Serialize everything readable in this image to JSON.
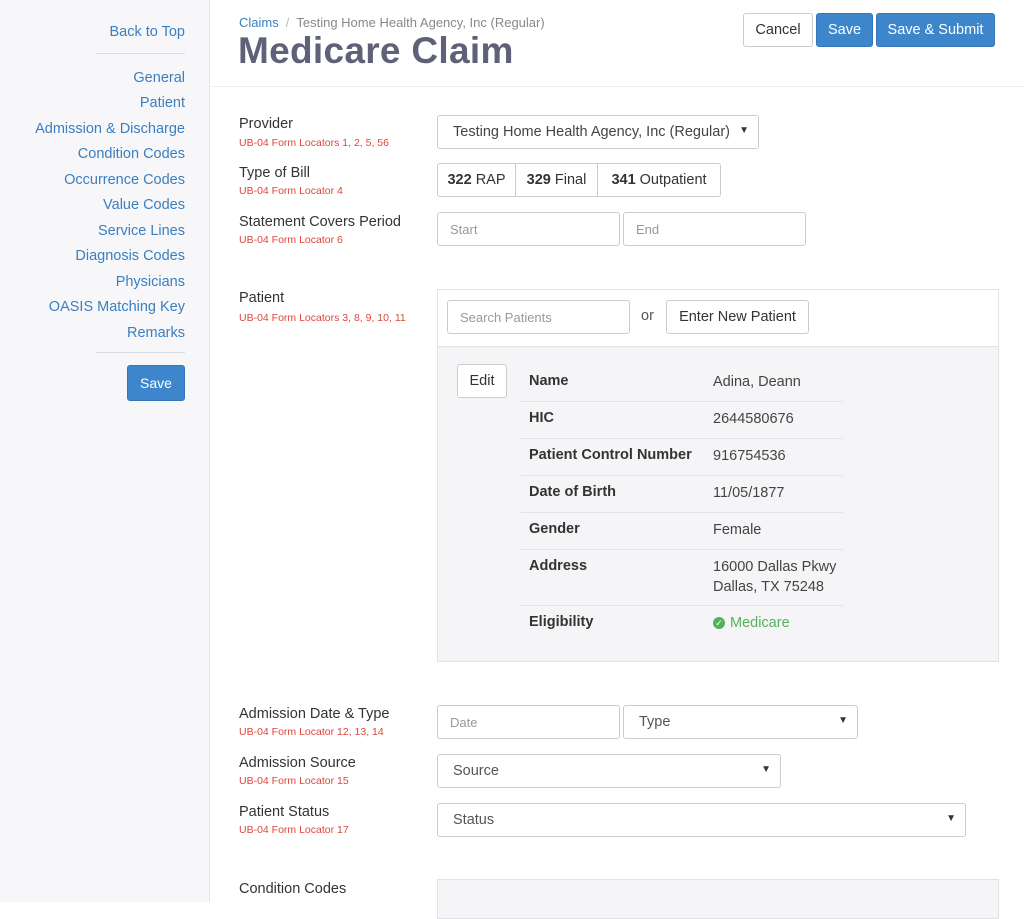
{
  "sidebar": {
    "back_to_top": "Back to Top",
    "items": [
      "General",
      "Patient",
      "Admission & Discharge",
      "Condition Codes",
      "Occurrence Codes",
      "Value Codes",
      "Service Lines",
      "Diagnosis Codes",
      "Physicians",
      "OASIS Matching Key",
      "Remarks"
    ],
    "save_label": "Save"
  },
  "header": {
    "breadcrumb_root": "Claims",
    "breadcrumb_current": "Testing Home Health Agency, Inc (Regular)",
    "title": "Medicare Claim",
    "cancel_label": "Cancel",
    "save_label": "Save",
    "save_submit_label": "Save & Submit"
  },
  "form": {
    "provider": {
      "label": "Provider",
      "sub": "UB-04 Form Locators 1, 2, 5, 56",
      "value": "Testing Home Health Agency, Inc (Regular)"
    },
    "type_of_bill": {
      "label": "Type of Bill",
      "sub": "UB-04 Form Locator 4",
      "options": [
        {
          "code": "322",
          "name": "RAP"
        },
        {
          "code": "329",
          "name": "Final"
        },
        {
          "code": "341",
          "name": "Outpatient"
        }
      ]
    },
    "statement_period": {
      "label": "Statement Covers Period",
      "sub": "UB-04 Form Locator 6",
      "start_placeholder": "Start",
      "end_placeholder": "End"
    },
    "patient": {
      "label": "Patient",
      "sub": "UB-04 Form Locators 3, 8, 9, 10, 11",
      "search_placeholder": "Search Patients",
      "or_text": "or",
      "new_patient_label": "Enter New Patient",
      "edit_label": "Edit",
      "info": [
        {
          "key": "Name",
          "value": "Adina, Deann"
        },
        {
          "key": "HIC",
          "value": "2644580676"
        },
        {
          "key": "Patient Control Number",
          "value": "916754536"
        },
        {
          "key": "Date of Birth",
          "value": "11/05/1877"
        },
        {
          "key": "Gender",
          "value": "Female"
        },
        {
          "key": "Address",
          "value": "16000 Dallas Pkwy",
          "value2": "Dallas, TX 75248"
        },
        {
          "key": "Eligibility",
          "value": "Medicare"
        }
      ]
    },
    "admission_date_type": {
      "label": "Admission Date & Type",
      "sub": "UB-04 Form Locator 12, 13, 14",
      "date_placeholder": "Date",
      "type_value": "Type"
    },
    "admission_source": {
      "label": "Admission Source",
      "sub": "UB-04 Form Locator 15",
      "value": "Source"
    },
    "patient_status": {
      "label": "Patient Status",
      "sub": "UB-04 Form Locator 17",
      "value": "Status"
    },
    "condition_codes": {
      "label": "Condition Codes"
    }
  },
  "colors": {
    "primary": "#3d86cb",
    "link": "#3a7fc1",
    "locator_red": "#e0463c",
    "title": "#5f6178",
    "success": "#57b05a"
  }
}
